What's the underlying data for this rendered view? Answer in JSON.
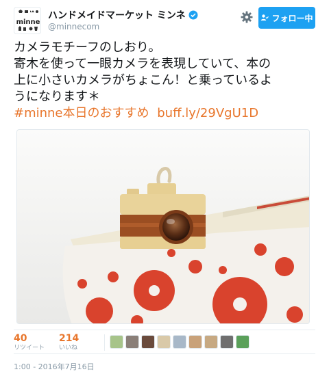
{
  "account": {
    "display_name": "ハンドメイドマーケット ミンネ",
    "screen_name": "@minnecom",
    "avatar_text": "minne",
    "verified_icon": "verified-badge-icon"
  },
  "actions": {
    "follow_label": "フォロー中",
    "settings_icon": "gear-icon"
  },
  "tweet": {
    "lines": [
      "カメラモチーフのしおり。",
      "寄木を使って一眼カメラを表現していて、本の",
      "上に小さいカメラがちょこん！と乗っているよ",
      "うになります＊"
    ],
    "hashtag": "#minne本日のおすすめ",
    "link": "buff.ly/29VgU1D"
  },
  "stats": {
    "retweets": {
      "count": "40",
      "label": "リツイート"
    },
    "likes": {
      "count": "214",
      "label": "いいね"
    },
    "liker_avatar_colors": [
      "#a7c48a",
      "#8a7f78",
      "#6a4b3c",
      "#d9c9a8",
      "#a8b8c8",
      "#c9a27a",
      "#c7a982",
      "#6f6f6f",
      "#5aa05a"
    ]
  },
  "timestamp": "1:00 - 2016年7月16日",
  "colors": {
    "accent": "#e8762c",
    "follow_button": "#1da1f2",
    "verified": "#1da1f2",
    "muted": "#8899a6"
  }
}
